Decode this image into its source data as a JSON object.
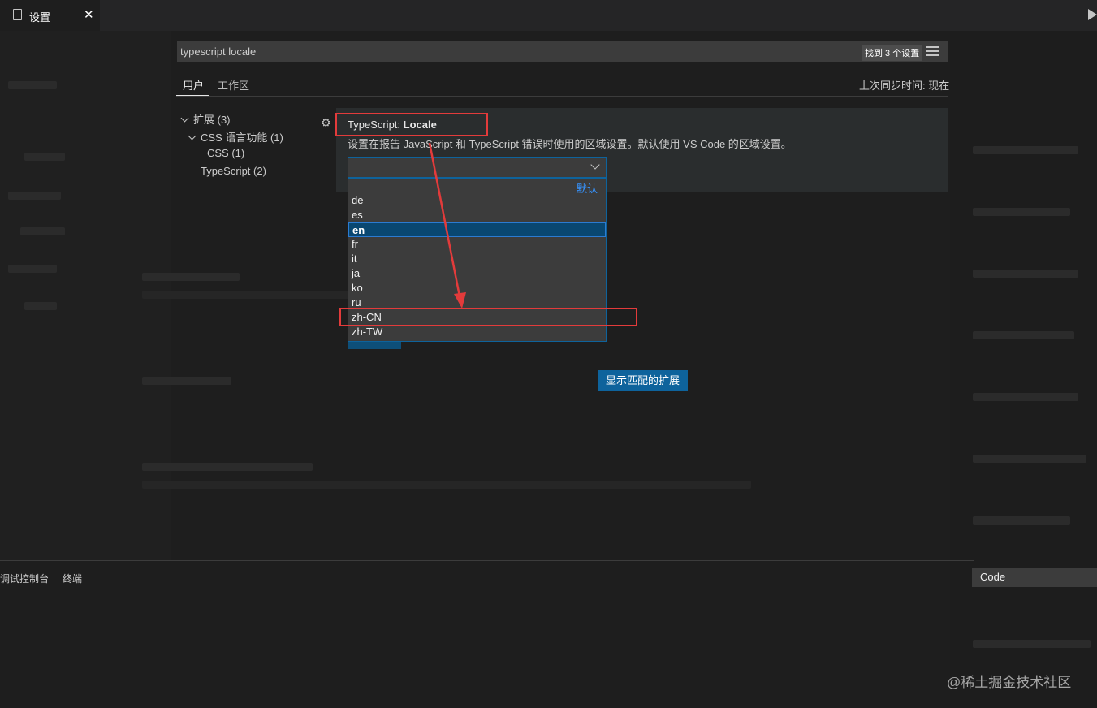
{
  "tab": {
    "title": "设置",
    "close": "✕"
  },
  "search": {
    "value": "typescript locale",
    "results_badge": "找到 3 个设置"
  },
  "scope": {
    "user": "用户",
    "workspace": "工作区",
    "sync": "上次同步时间: 现在"
  },
  "tree": {
    "extensions": "扩展 (3)",
    "css_lang": "CSS 语言功能 (1)",
    "css": "CSS (1)",
    "typescript": "TypeScript (2)"
  },
  "setting": {
    "category": "TypeScript: ",
    "name": "Locale",
    "description": "设置在报告 JavaScript 和 TypeScript 错误时使用的区域设置。默认使用 VS Code 的区域设置。",
    "default_label": "默认",
    "options": [
      "de",
      "es",
      "en",
      "fr",
      "it",
      "ja",
      "ko",
      "ru",
      "zh-CN",
      "zh-TW"
    ],
    "highlighted_option": "en",
    "annotated_option": "zh-CN"
  },
  "buttons": {
    "show_matching_extensions": "显示匹配的扩展"
  },
  "panel": {
    "debug_console": "调试控制台",
    "terminal": "终端",
    "output_source": "Code"
  },
  "watermark": "@稀土掘金技术社区",
  "colors": {
    "accent": "#0e639c",
    "annotation": "#e33b3b",
    "link": "#3794ff"
  }
}
